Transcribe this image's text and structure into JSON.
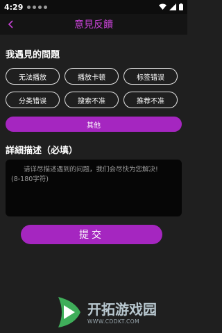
{
  "status_bar": {
    "time": "4:29"
  },
  "header": {
    "title": "意見反饋"
  },
  "problems": {
    "title": "我遇見的問題",
    "tags": [
      "无法播放",
      "播放卡顿",
      "标签错误",
      "分类错误",
      "搜索不准",
      "推荐不准"
    ],
    "other": "其他"
  },
  "details": {
    "title": "詳細描述（必填）",
    "placeholder_line1": "请详尽描述遇到的问题，我们会尽快为您解决!",
    "placeholder_line2": "(8-180字符)"
  },
  "submit": {
    "label": "提交"
  },
  "watermark": {
    "name": "开拓游戏园",
    "url": "WWW.CDDKT.COM"
  },
  "colors": {
    "accent": "#a526c0",
    "title_accent": "#c742d6",
    "background": "#1f1f1f"
  }
}
